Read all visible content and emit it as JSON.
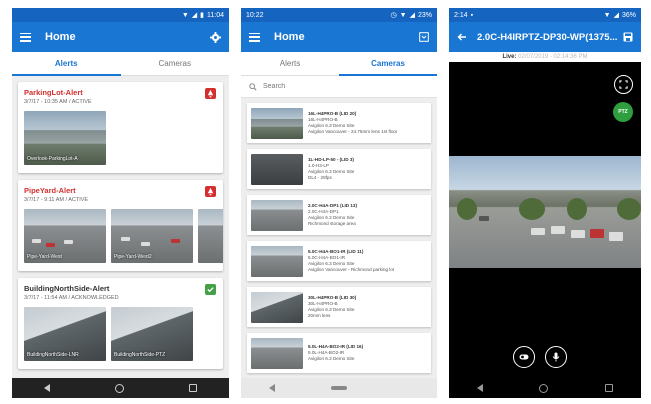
{
  "phone1": {
    "status": {
      "time": "11:04"
    },
    "toolbar": {
      "title": "Home"
    },
    "tabs": [
      {
        "label": "Alerts"
      },
      {
        "label": "Cameras"
      }
    ],
    "alerts": [
      {
        "title": "ParkingLot-Alert",
        "sub": "3/7/17 - 10:35 AM / ACTIVE",
        "badge": "red",
        "thumbs": [
          {
            "label": "Overlook-ParkingLot-A"
          }
        ]
      },
      {
        "title": "PipeYard-Alert",
        "sub": "3/7/17 - 9:11 AM / ACTIVE",
        "badge": "red",
        "thumbs": [
          {
            "label": "Pipe-Yard-West"
          },
          {
            "label": "Pipe-Yard-West2"
          },
          {
            "label": ""
          }
        ]
      },
      {
        "title": "BuildingNorthSide-Alert",
        "sub": "3/7/17 - 11:54 AM / ACKNOWLEDGED",
        "badge": "green",
        "thumbs": [
          {
            "label": "BuildingNorthSide-LNR"
          },
          {
            "label": "BuildingNorthSide-PTZ"
          }
        ]
      }
    ]
  },
  "phone2": {
    "status": {
      "time": "10:22",
      "battery": "23%"
    },
    "toolbar": {
      "title": "Home"
    },
    "tabs": [
      {
        "label": "Alerts"
      },
      {
        "label": "Cameras"
      }
    ],
    "search": {
      "placeholder": "Search"
    },
    "cameras": [
      {
        "name": "16L-H4PRO-B (LID 20)",
        "model": "16L-H4PRO-B",
        "site": "Avigilon 6.3 Demo Site",
        "desc": "Avigilon Vancouver - 24.75mm lens 1st floor"
      },
      {
        "name": "1L-HD-LP-50 - (LID 3)",
        "model": "1.0-H3-LP",
        "site": "Avigilon 6.3 Demo Site",
        "desc": "DL4 - 28fps"
      },
      {
        "name": "2.0C-H4A-DP1 (LID 13)",
        "model": "2.0C-H4A-DP1",
        "site": "Avigilon 6.3 Demo Site",
        "desc": "Richmond storage area"
      },
      {
        "name": "5.0C-H4A-BO1-IR (LID 11)",
        "model": "5.0C-H4A-BO1-IR",
        "site": "Avigilon 6.3 Demo Site",
        "desc": "Avigilon Vancouver - Richmond parking lot"
      },
      {
        "name": "30L-H4PRO-B (LID 30)",
        "model": "30L-H4PRO-B",
        "site": "Avigilon 6.3 Demo Site",
        "desc": "20mm lens"
      },
      {
        "name": "5.0L-H4A-BO2-IR (LID 16)",
        "model": "5.0L-H4A-BO2-IR",
        "site": "Avigilon 6.3 Demo Site",
        "desc": ""
      }
    ]
  },
  "phone3": {
    "status": {
      "time": "2:14",
      "battery": "36%"
    },
    "toolbar": {
      "title": "2.0C-H4IRPTZ-DP30-WP(1375..."
    },
    "live": {
      "label": "Live:",
      "timestamp": "02/07/2019 - 02:14:36 PM"
    },
    "ptz_label": "PTZ"
  },
  "colors": {
    "primary": "#1976d2",
    "alert_red": "#d32f2f",
    "ack_green": "#43a047",
    "ptz_green": "#2e9e3e"
  }
}
